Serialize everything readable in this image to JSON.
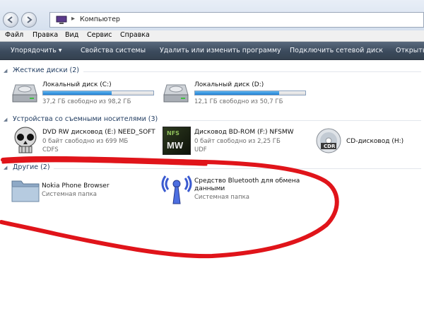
{
  "address": {
    "path": "Компьютер"
  },
  "menu": {
    "file": "Файл",
    "edit": "Правка",
    "view": "Вид",
    "service": "Сервис",
    "help": "Справка"
  },
  "commands": {
    "organize": "Упорядочить",
    "system_properties": "Свойства системы",
    "uninstall": "Удалить или изменить программу",
    "map_drive": "Подключить сетевой диск",
    "open_panel": "Открыть"
  },
  "groups": {
    "hard_disks": {
      "header": "Жесткие диски (2)",
      "items": [
        {
          "name": "Локальный диск (C:)",
          "detail": "37,2 ГБ свободно из 98,2 ГБ",
          "used_fraction": 0.62
        },
        {
          "name": "Локальный диск (D:)",
          "detail": "12,1 ГБ свободно из 50,7 ГБ",
          "used_fraction": 0.76
        }
      ]
    },
    "removable": {
      "header": "Устройства со съемными носителями (3)",
      "items": [
        {
          "name": "DVD RW дисковод (E:) NEED_SOFT",
          "detail": "0 байт свободно из 699 МБ",
          "fs": "CDFS"
        },
        {
          "name": "Дисковод BD-ROM (F:) NFSMW",
          "detail": "0 байт свободно из 2,25 ГБ",
          "fs": "UDF",
          "icon_text": "MW"
        },
        {
          "name": "CD-дисковод (H:)",
          "icon_text": "CDR"
        }
      ]
    },
    "other": {
      "header": "Другие (2)",
      "items": [
        {
          "name": "Nokia Phone Browser",
          "detail": "Системная папка"
        },
        {
          "name_line1": "Средство Bluetooth для обмена",
          "name_line2": "данными",
          "detail": "Системная папка"
        }
      ]
    }
  },
  "colors": {
    "annotation": "#e0141a",
    "accent": "#1f7fd3",
    "command_bar": "#3c4b5d"
  }
}
